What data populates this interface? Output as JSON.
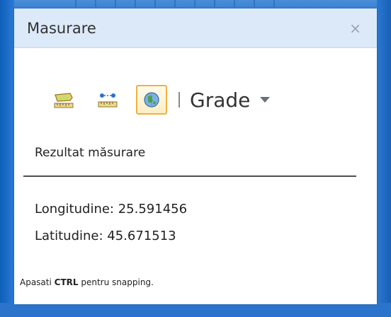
{
  "window": {
    "title": "Masurare",
    "close_label": "×"
  },
  "toolbar": {
    "tools": [
      {
        "icon": "area-measure-icon"
      },
      {
        "icon": "distance-measure-icon"
      },
      {
        "icon": "location-measure-icon",
        "active": true
      }
    ],
    "units_selected": "Grade"
  },
  "result": {
    "heading": "Rezultat măsurare",
    "longitude": "Longitudine: 25.591456",
    "latitude": "Latitudine: 45.671513"
  },
  "hint": {
    "prefix": "Apasati",
    "key": "CTRL",
    "suffix": "pentru snapping."
  },
  "colors": {
    "desktop": "#1f6cc4",
    "titlebar": "#dce9f8",
    "active_tool_border": "#f0b040"
  }
}
